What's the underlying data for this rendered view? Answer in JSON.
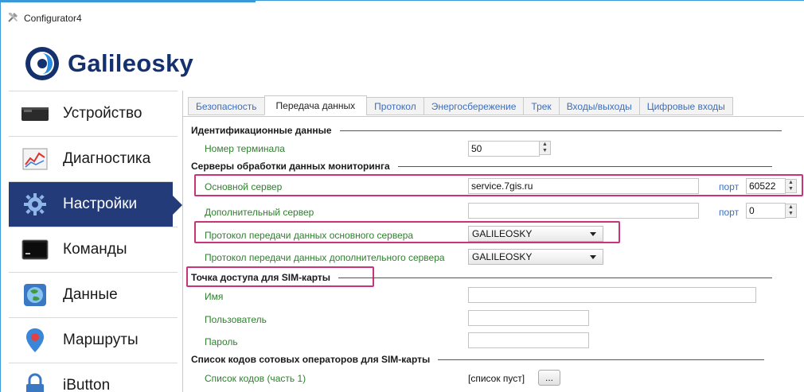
{
  "window": {
    "title": "Configurator4"
  },
  "brand": {
    "name": "Galileosky",
    "color": "#14316e"
  },
  "colors": {
    "accent": "#243b7a",
    "highlight": "#c8337a",
    "label": "#2f7f2f",
    "tab_link": "#3b6ebd"
  },
  "sidebar": {
    "items": [
      {
        "label": "Устройство",
        "icon": "device-icon"
      },
      {
        "label": "Диагностика",
        "icon": "chart-icon"
      },
      {
        "label": "Настройки",
        "icon": "gear-icon",
        "active": true
      },
      {
        "label": "Команды",
        "icon": "terminal-icon"
      },
      {
        "label": "Данные",
        "icon": "globe-icon"
      },
      {
        "label": "Маршруты",
        "icon": "map-pin-icon"
      },
      {
        "label": "iButton",
        "icon": "lock-icon"
      }
    ]
  },
  "tabs": [
    {
      "label": "Безопасность"
    },
    {
      "label": "Передача данных",
      "active": true
    },
    {
      "label": "Протокол"
    },
    {
      "label": "Энергосбережение"
    },
    {
      "label": "Трек"
    },
    {
      "label": "Входы/выходы"
    },
    {
      "label": "Цифровые входы"
    }
  ],
  "form": {
    "id_section": "Идентификационные данные",
    "terminal_label": "Номер терминала",
    "terminal_value": "50",
    "servers_section": "Серверы обработки данных мониторинга",
    "main_server_label": "Основной сервер",
    "main_server_value": "service.7gis.ru",
    "port_label": "порт",
    "main_port_value": "60522",
    "extra_server_label": "Дополнительный сервер",
    "extra_server_value": "",
    "extra_port_value": "0",
    "main_protocol_label": "Протокол передачи данных основного сервера",
    "main_protocol_value": "GALILEOSKY",
    "extra_protocol_label": "Протокол передачи данных дополнительного сервера",
    "extra_protocol_value": "GALILEOSKY",
    "apn_section": "Точка доступа для SIM-карты",
    "apn_name_label": "Имя",
    "apn_user_label": "Пользователь",
    "apn_pass_label": "Пароль",
    "codes_section": "Список кодов сотовых операторов для SIM-карты",
    "codes_label": "Список кодов (часть 1)",
    "codes_value": "[список пуст]",
    "codes_button": "..."
  }
}
